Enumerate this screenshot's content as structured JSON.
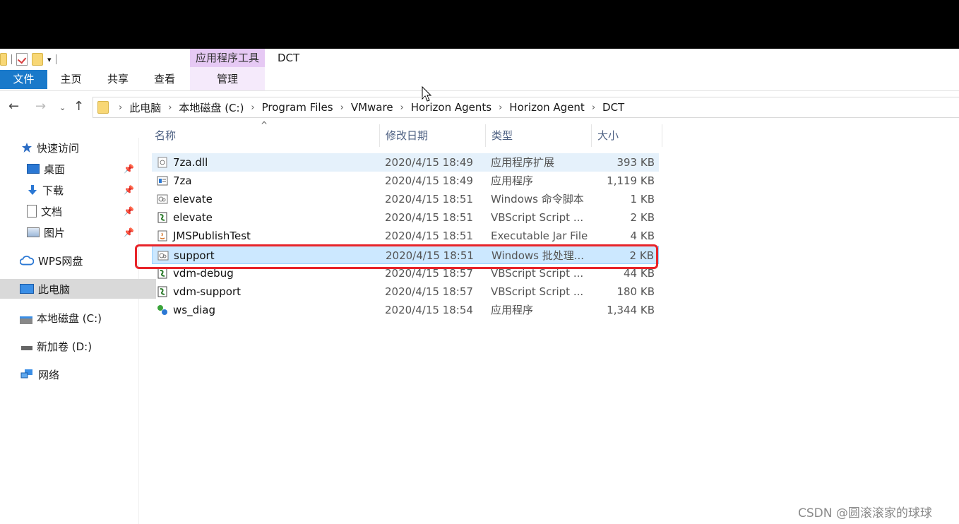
{
  "window": {
    "title": "DCT",
    "context_tab_group": "应用程序工具"
  },
  "ribbon_tabs": [
    {
      "label": "文件"
    },
    {
      "label": "主页"
    },
    {
      "label": "共享"
    },
    {
      "label": "查看"
    },
    {
      "label": "管理"
    }
  ],
  "breadcrumb": [
    "此电脑",
    "本地磁盘 (C:)",
    "Program Files",
    "VMware",
    "Horizon Agents",
    "Horizon Agent",
    "DCT"
  ],
  "sidebar": {
    "items": [
      {
        "label": "快速访问",
        "icon": "star-icon"
      },
      {
        "label": "桌面",
        "icon": "desktop-icon",
        "pinned": true
      },
      {
        "label": "下载",
        "icon": "download-icon",
        "pinned": true
      },
      {
        "label": "文档",
        "icon": "document-icon",
        "pinned": true
      },
      {
        "label": "图片",
        "icon": "pictures-icon",
        "pinned": true
      },
      {
        "label": "WPS网盘",
        "icon": "cloud-icon"
      },
      {
        "label": "此电脑",
        "icon": "computer-icon",
        "selected": true
      },
      {
        "label": "本地磁盘 (C:)",
        "icon": "drive-icon"
      },
      {
        "label": "新加卷 (D:)",
        "icon": "drive-icon"
      },
      {
        "label": "网络",
        "icon": "network-icon"
      }
    ]
  },
  "columns": {
    "name": "名称",
    "date": "修改日期",
    "type": "类型",
    "size": "大小"
  },
  "files": [
    {
      "name": "7za.dll",
      "date": "2020/4/15 18:49",
      "type": "应用程序扩展",
      "size": "393 KB",
      "icon": "dll-icon"
    },
    {
      "name": "7za",
      "date": "2020/4/15 18:49",
      "type": "应用程序",
      "size": "1,119 KB",
      "icon": "exe-icon"
    },
    {
      "name": "elevate",
      "date": "2020/4/15 18:51",
      "type": "Windows 命令脚本",
      "size": "1 KB",
      "icon": "cmd-icon"
    },
    {
      "name": "elevate",
      "date": "2020/4/15 18:51",
      "type": "VBScript Script ...",
      "size": "2 KB",
      "icon": "vbs-icon"
    },
    {
      "name": "JMSPublishTest",
      "date": "2020/4/15 18:51",
      "type": "Executable Jar File",
      "size": "4 KB",
      "icon": "jar-icon"
    },
    {
      "name": "support",
      "date": "2020/4/15 18:51",
      "type": "Windows 批处理...",
      "size": "2 KB",
      "icon": "bat-icon"
    },
    {
      "name": "vdm-debug",
      "date": "2020/4/15 18:57",
      "type": "VBScript Script ...",
      "size": "44 KB",
      "icon": "vbs-icon"
    },
    {
      "name": "vdm-support",
      "date": "2020/4/15 18:57",
      "type": "VBScript Script ...",
      "size": "180 KB",
      "icon": "vbs-icon"
    },
    {
      "name": "ws_diag",
      "date": "2020/4/15 18:54",
      "type": "应用程序",
      "size": "1,344 KB",
      "icon": "exe-icon"
    }
  ],
  "watermark": "CSDN @圆滚滚家的球球",
  "colors": {
    "accent": "#1979ca",
    "highlight_box": "#e8242a",
    "selection": "#cce8ff"
  }
}
